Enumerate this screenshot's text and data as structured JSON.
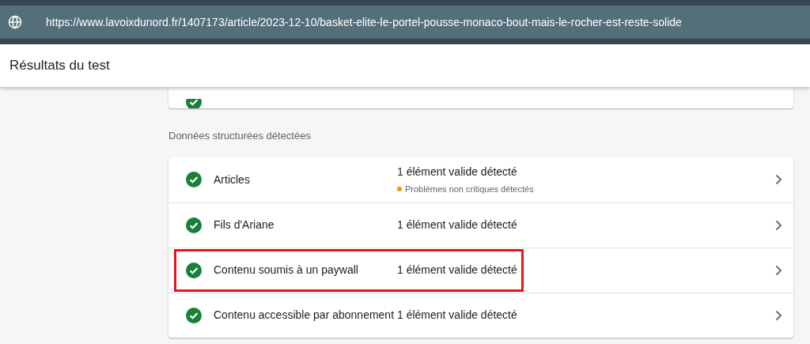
{
  "address_bar": {
    "url": "https://www.lavoixdunord.fr/1407173/article/2023-12-10/basket-elite-le-portel-pousse-monaco-bout-mais-le-rocher-est-reste-solide"
  },
  "header": {
    "title": "Résultats du test"
  },
  "section": {
    "title": "Données structurées détectées"
  },
  "rows": [
    {
      "name": "Articles",
      "status": "1 élément valide détecté",
      "warning": {
        "text": "Problèmes non critiques détectés",
        "color": "#f29900"
      },
      "highlighted": false
    },
    {
      "name": "Fils d'Ariane",
      "status": "1 élément valide détecté",
      "highlighted": false
    },
    {
      "name": "Contenu soumis à un paywall",
      "status": "1 élément valide détecté",
      "highlighted": true
    },
    {
      "name": "Contenu accessible par abonnement",
      "status": "1 élément valide détecté",
      "highlighted": false
    }
  ]
}
